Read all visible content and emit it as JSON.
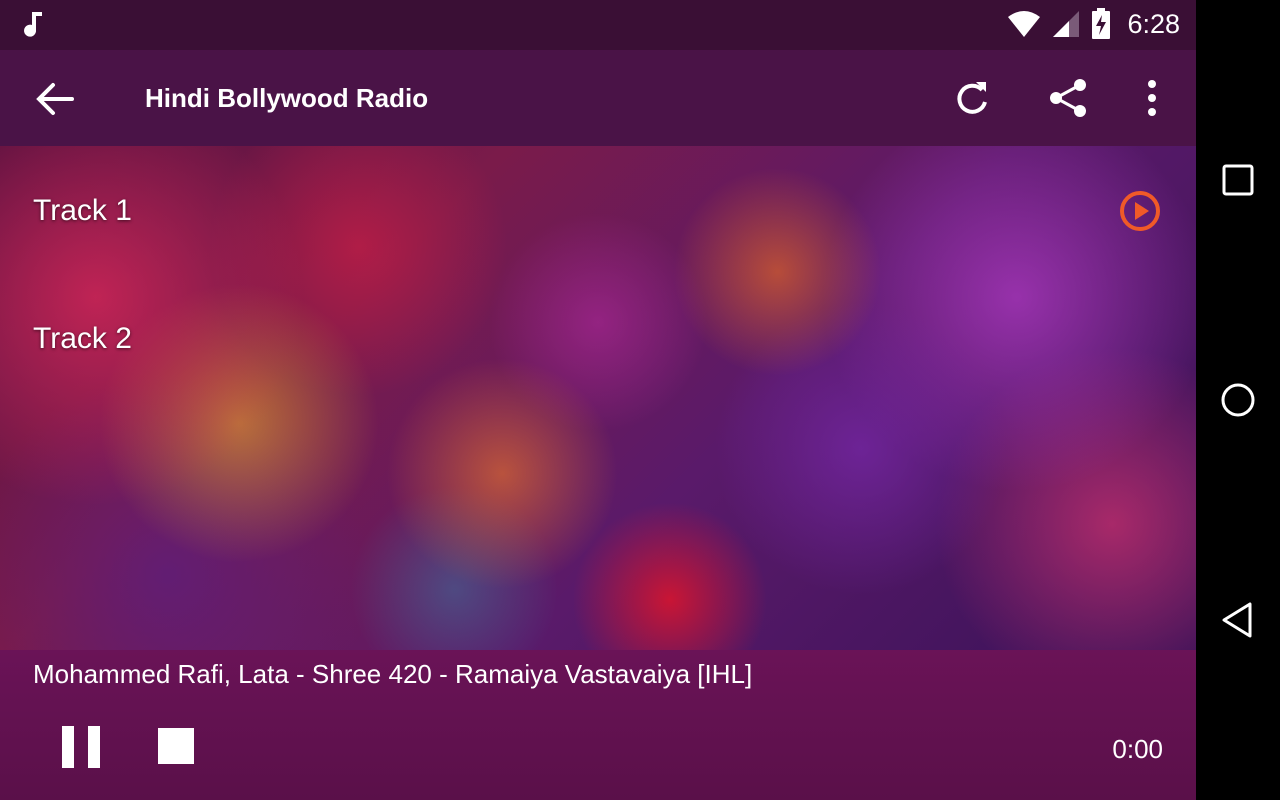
{
  "status_bar": {
    "time": "6:28",
    "icons": [
      "music-note-icon",
      "wifi-icon",
      "cell-signal-icon",
      "battery-charging-icon"
    ]
  },
  "app_bar": {
    "title": "Hindi Bollywood Radio",
    "icons": [
      "back-arrow-icon",
      "refresh-icon",
      "share-icon",
      "more-vert-icon"
    ]
  },
  "tracks": [
    {
      "label": "Track 1",
      "playing": true
    },
    {
      "label": "Track 2",
      "playing": false
    }
  ],
  "player": {
    "now_playing": "Mohammed Rafi, Lata - Shree 420 - Ramaiya Vastavaiya [IHL]",
    "elapsed": "0:00",
    "controls": [
      "pause-icon",
      "stop-icon"
    ]
  },
  "nav_bar": {
    "icons": [
      "recent-apps-icon",
      "home-icon",
      "back-nav-icon"
    ]
  },
  "colors": {
    "status_bar": "#3a0f35",
    "app_bar": "#4a1347",
    "player_bar": "#6a1357",
    "play_accent": "#f05a28"
  }
}
